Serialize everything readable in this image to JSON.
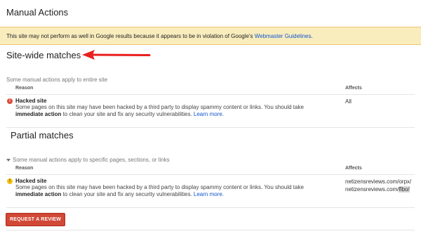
{
  "page": {
    "title": "Manual Actions"
  },
  "notice": {
    "text": "This site may not perform as well in Google results because it appears to be in violation of Google's ",
    "link": "Webmaster Guidelines",
    "suffix": "."
  },
  "sitewide": {
    "title": "Site-wide matches",
    "subtitle": "Some manual actions apply to entire site",
    "reason_header": "Reason",
    "affects_header": "Affects",
    "issue": {
      "title": "Hacked site",
      "desc_start": "Some pages on this site may have been hacked by a third party to display spammy content or links. You should take ",
      "desc_bold": "immediate action",
      "desc_end": " to clean your site and fix any security vulnerabilities. ",
      "learn_more": "Learn more.",
      "affects": "All"
    }
  },
  "partial": {
    "title": "Partial matches",
    "subtitle": "Some manual actions apply to specific pages, sections, or links",
    "reason_header": "Reason",
    "affects_header": "Affects",
    "issue": {
      "title": "Hacked site",
      "desc_start": "Some pages on this site may have been hacked by a third party to display spammy content or links. You should take ",
      "desc_bold": "immediate action",
      "desc_end": " to clean your site and fix any security vulnerabilities. ",
      "learn_more": "Learn more.",
      "affects_1": "netizensreviews.com/orpx/",
      "affects_2_base": "netizensreviews.com/",
      "affects_2_highlight": "flbo/"
    }
  },
  "actions": {
    "request_review": "REQUEST A REVIEW"
  },
  "colors": {
    "notice_bg": "#f9edbe",
    "link": "#1155cc",
    "button": "#d14836",
    "error": "#dd4b39",
    "warning": "#f4c20d",
    "arrow": "#e8201e"
  },
  "icons": {
    "sitewide_status": "error-icon",
    "partial_status": "warning-icon",
    "annotation": "red-arrow-icon"
  }
}
